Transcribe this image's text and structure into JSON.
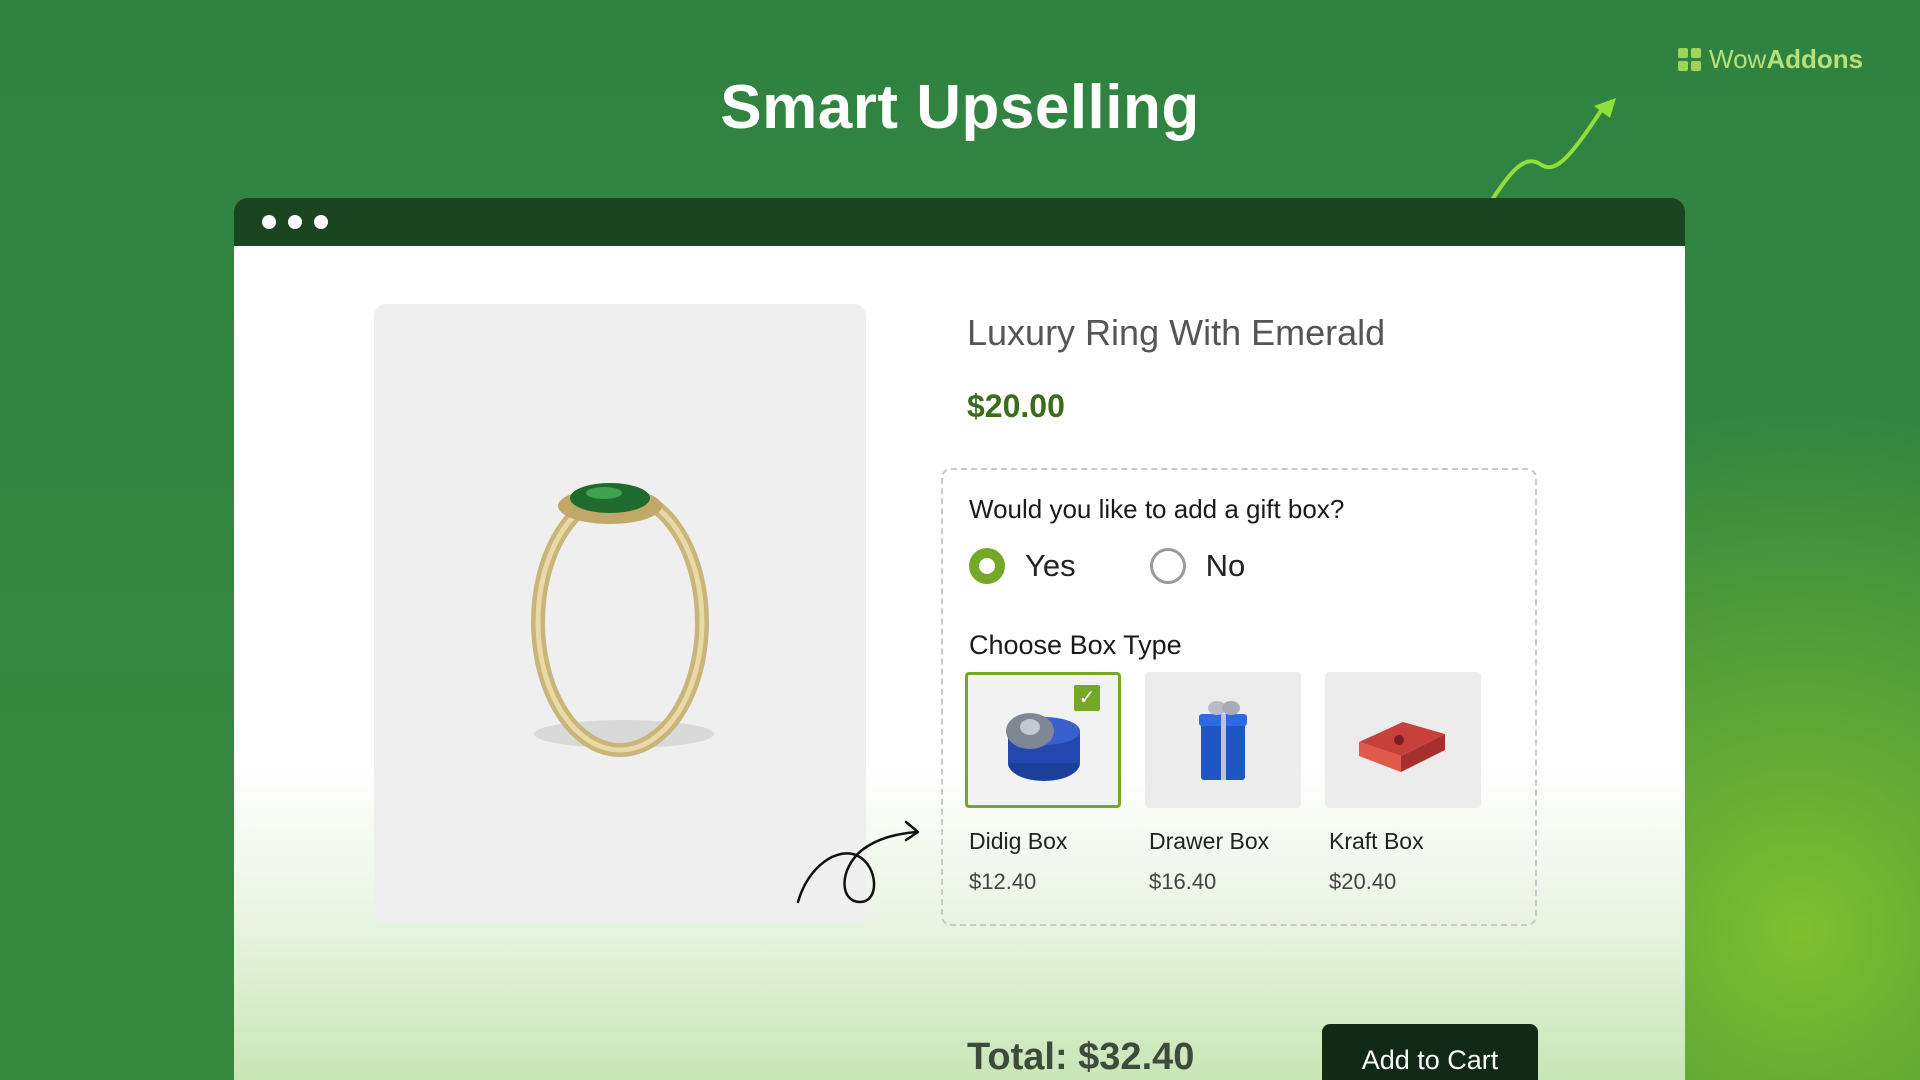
{
  "brand": {
    "name_light": "Wow",
    "name_bold": "Addons"
  },
  "headline": "Smart Upselling",
  "product": {
    "title": "Luxury Ring With Emerald",
    "price": "$20.00"
  },
  "gift_box": {
    "question": "Would you like to add a gift box?",
    "options": [
      {
        "label": "Yes",
        "selected": true
      },
      {
        "label": "No",
        "selected": false
      }
    ],
    "choose_label": "Choose Box Type",
    "box_types": [
      {
        "name": "Didig Box",
        "price": "$12.40",
        "selected": true,
        "icon": "blue-round-gift-box-icon"
      },
      {
        "name": "Drawer Box",
        "price": "$16.40",
        "selected": false,
        "icon": "blue-tall-gift-box-icon"
      },
      {
        "name": "Kraft Box",
        "price": "$20.40",
        "selected": false,
        "icon": "red-gift-box-icon"
      }
    ]
  },
  "footer": {
    "total": "Total: $32.40",
    "add_to_cart": "Add to Cart"
  },
  "colors": {
    "background": "#33863f",
    "accent": "#76a828",
    "price": "#3c6b1a",
    "button": "#122916"
  }
}
